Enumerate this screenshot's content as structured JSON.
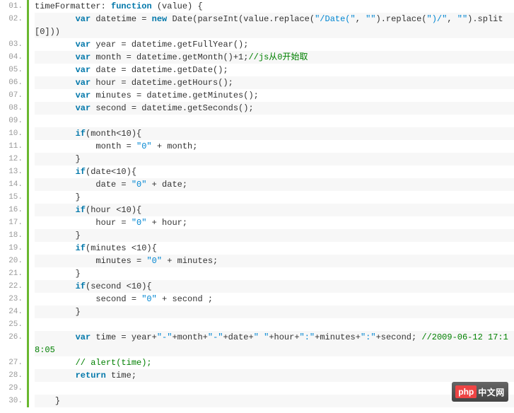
{
  "logo": {
    "part1": "php",
    "part2": "中文网"
  },
  "lines": [
    {
      "n": "01.",
      "even": false,
      "wrap": false,
      "tokens": [
        {
          "t": "plain",
          "v": "timeFormatter: "
        },
        {
          "t": "keyword",
          "v": "function"
        },
        {
          "t": "plain",
          "v": " (value) {"
        }
      ]
    },
    {
      "n": "02.",
      "even": true,
      "wrap": true,
      "tokens": [
        {
          "t": "plain",
          "v": "        "
        },
        {
          "t": "keyword",
          "v": "var"
        },
        {
          "t": "plain",
          "v": " datetime = "
        },
        {
          "t": "keyword",
          "v": "new"
        },
        {
          "t": "plain",
          "v": " Date(parseInt(value.replace("
        },
        {
          "t": "string",
          "v": "\"/Date(\""
        },
        {
          "t": "plain",
          "v": ", "
        },
        {
          "t": "string",
          "v": "\"\""
        },
        {
          "t": "plain",
          "v": ").replace("
        },
        {
          "t": "string",
          "v": "\")/\""
        },
        {
          "t": "plain",
          "v": ", "
        },
        {
          "t": "string",
          "v": "\"\""
        },
        {
          "t": "plain",
          "v": ").split[0]))"
        }
      ]
    },
    {
      "n": "03.",
      "even": false,
      "wrap": false,
      "tokens": [
        {
          "t": "plain",
          "v": "        "
        },
        {
          "t": "keyword",
          "v": "var"
        },
        {
          "t": "plain",
          "v": " year = datetime.getFullYear();"
        }
      ]
    },
    {
      "n": "04.",
      "even": true,
      "wrap": false,
      "tokens": [
        {
          "t": "plain",
          "v": "        "
        },
        {
          "t": "keyword",
          "v": "var"
        },
        {
          "t": "plain",
          "v": " month = datetime.getMonth()+1;"
        },
        {
          "t": "comment",
          "v": "//js从0开始取"
        }
      ]
    },
    {
      "n": "05.",
      "even": false,
      "wrap": false,
      "tokens": [
        {
          "t": "plain",
          "v": "        "
        },
        {
          "t": "keyword",
          "v": "var"
        },
        {
          "t": "plain",
          "v": " date = datetime.getDate();"
        }
      ]
    },
    {
      "n": "06.",
      "even": true,
      "wrap": false,
      "tokens": [
        {
          "t": "plain",
          "v": "        "
        },
        {
          "t": "keyword",
          "v": "var"
        },
        {
          "t": "plain",
          "v": " hour = datetime.getHours();"
        }
      ]
    },
    {
      "n": "07.",
      "even": false,
      "wrap": false,
      "tokens": [
        {
          "t": "plain",
          "v": "        "
        },
        {
          "t": "keyword",
          "v": "var"
        },
        {
          "t": "plain",
          "v": " minutes = datetime.getMinutes();"
        }
      ]
    },
    {
      "n": "08.",
      "even": true,
      "wrap": false,
      "tokens": [
        {
          "t": "plain",
          "v": "        "
        },
        {
          "t": "keyword",
          "v": "var"
        },
        {
          "t": "plain",
          "v": " second = datetime.getSeconds();"
        }
      ]
    },
    {
      "n": "09.",
      "even": false,
      "wrap": false,
      "tokens": [
        {
          "t": "plain",
          "v": " "
        }
      ]
    },
    {
      "n": "10.",
      "even": true,
      "wrap": false,
      "tokens": [
        {
          "t": "plain",
          "v": "        "
        },
        {
          "t": "keyword",
          "v": "if"
        },
        {
          "t": "plain",
          "v": "(month<10){"
        }
      ]
    },
    {
      "n": "11.",
      "even": false,
      "wrap": false,
      "tokens": [
        {
          "t": "plain",
          "v": "            month = "
        },
        {
          "t": "string",
          "v": "\"0\""
        },
        {
          "t": "plain",
          "v": " + month;"
        }
      ]
    },
    {
      "n": "12.",
      "even": true,
      "wrap": false,
      "tokens": [
        {
          "t": "plain",
          "v": "        }"
        }
      ]
    },
    {
      "n": "13.",
      "even": false,
      "wrap": false,
      "tokens": [
        {
          "t": "plain",
          "v": "        "
        },
        {
          "t": "keyword",
          "v": "if"
        },
        {
          "t": "plain",
          "v": "(date<10){"
        }
      ]
    },
    {
      "n": "14.",
      "even": true,
      "wrap": false,
      "tokens": [
        {
          "t": "plain",
          "v": "            date = "
        },
        {
          "t": "string",
          "v": "\"0\""
        },
        {
          "t": "plain",
          "v": " + date;"
        }
      ]
    },
    {
      "n": "15.",
      "even": false,
      "wrap": false,
      "tokens": [
        {
          "t": "plain",
          "v": "        }"
        }
      ]
    },
    {
      "n": "16.",
      "even": true,
      "wrap": false,
      "tokens": [
        {
          "t": "plain",
          "v": "        "
        },
        {
          "t": "keyword",
          "v": "if"
        },
        {
          "t": "plain",
          "v": "(hour <10){"
        }
      ]
    },
    {
      "n": "17.",
      "even": false,
      "wrap": false,
      "tokens": [
        {
          "t": "plain",
          "v": "            hour = "
        },
        {
          "t": "string",
          "v": "\"0\""
        },
        {
          "t": "plain",
          "v": " + hour;"
        }
      ]
    },
    {
      "n": "18.",
      "even": true,
      "wrap": false,
      "tokens": [
        {
          "t": "plain",
          "v": "        }"
        }
      ]
    },
    {
      "n": "19.",
      "even": false,
      "wrap": false,
      "tokens": [
        {
          "t": "plain",
          "v": "        "
        },
        {
          "t": "keyword",
          "v": "if"
        },
        {
          "t": "plain",
          "v": "(minutes <10){"
        }
      ]
    },
    {
      "n": "20.",
      "even": true,
      "wrap": false,
      "tokens": [
        {
          "t": "plain",
          "v": "            minutes = "
        },
        {
          "t": "string",
          "v": "\"0\""
        },
        {
          "t": "plain",
          "v": " + minutes;"
        }
      ]
    },
    {
      "n": "21.",
      "even": false,
      "wrap": false,
      "tokens": [
        {
          "t": "plain",
          "v": "        }"
        }
      ]
    },
    {
      "n": "22.",
      "even": true,
      "wrap": false,
      "tokens": [
        {
          "t": "plain",
          "v": "        "
        },
        {
          "t": "keyword",
          "v": "if"
        },
        {
          "t": "plain",
          "v": "(second <10){"
        }
      ]
    },
    {
      "n": "23.",
      "even": false,
      "wrap": false,
      "tokens": [
        {
          "t": "plain",
          "v": "            second = "
        },
        {
          "t": "string",
          "v": "\"0\""
        },
        {
          "t": "plain",
          "v": " + second ;"
        }
      ]
    },
    {
      "n": "24.",
      "even": true,
      "wrap": false,
      "tokens": [
        {
          "t": "plain",
          "v": "        }"
        }
      ]
    },
    {
      "n": "25.",
      "even": false,
      "wrap": false,
      "tokens": [
        {
          "t": "plain",
          "v": " "
        }
      ]
    },
    {
      "n": "26.",
      "even": true,
      "wrap": true,
      "tokens": [
        {
          "t": "plain",
          "v": "        "
        },
        {
          "t": "keyword",
          "v": "var"
        },
        {
          "t": "plain",
          "v": " time = year+"
        },
        {
          "t": "string",
          "v": "\"-\""
        },
        {
          "t": "plain",
          "v": "+month+"
        },
        {
          "t": "string",
          "v": "\"-\""
        },
        {
          "t": "plain",
          "v": "+date+"
        },
        {
          "t": "string",
          "v": "\" \""
        },
        {
          "t": "plain",
          "v": "+hour+"
        },
        {
          "t": "string",
          "v": "\":\""
        },
        {
          "t": "plain",
          "v": "+minutes+"
        },
        {
          "t": "string",
          "v": "\":\""
        },
        {
          "t": "plain",
          "v": "+second; "
        },
        {
          "t": "comment",
          "v": "//2009-06-12 17:18:05"
        }
      ]
    },
    {
      "n": "27.",
      "even": false,
      "wrap": false,
      "tokens": [
        {
          "t": "plain",
          "v": "        "
        },
        {
          "t": "comment",
          "v": "// alert(time);"
        }
      ]
    },
    {
      "n": "28.",
      "even": true,
      "wrap": false,
      "tokens": [
        {
          "t": "plain",
          "v": "        "
        },
        {
          "t": "keyword",
          "v": "return"
        },
        {
          "t": "plain",
          "v": " time;"
        }
      ]
    },
    {
      "n": "29.",
      "even": false,
      "wrap": false,
      "tokens": [
        {
          "t": "plain",
          "v": " "
        }
      ]
    },
    {
      "n": "30.",
      "even": true,
      "wrap": false,
      "tokens": [
        {
          "t": "plain",
          "v": "    }"
        }
      ]
    }
  ]
}
